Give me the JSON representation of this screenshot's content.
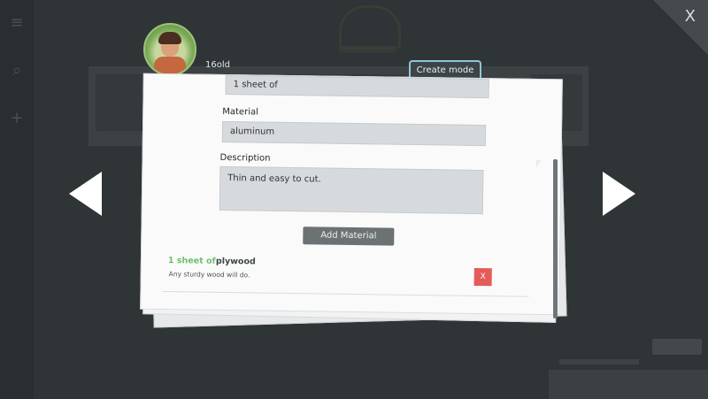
{
  "header": {
    "username": "16old",
    "create_mode_label": "Create mode",
    "close_label": "X"
  },
  "form": {
    "quantity_value": "1 sheet of",
    "material_label": "Material",
    "material_value": "aluminum",
    "description_label": "Description",
    "description_value": "Thin and easy to cut.",
    "add_material_label": "Add Material"
  },
  "materials": [
    {
      "quantity": "1 sheet of",
      "name": "plywood",
      "description": "Any sturdy wood will do.",
      "delete_label": "X"
    }
  ],
  "icons": {
    "nav_left": "chevron-left-icon",
    "nav_right": "chevron-right-icon",
    "search": "search-icon",
    "add": "plus-icon",
    "menu": "menu-icon"
  },
  "colors": {
    "accent_border": "#8fc5d6",
    "delete_red": "#e45b57",
    "quantity_green": "#6fbf6a"
  }
}
